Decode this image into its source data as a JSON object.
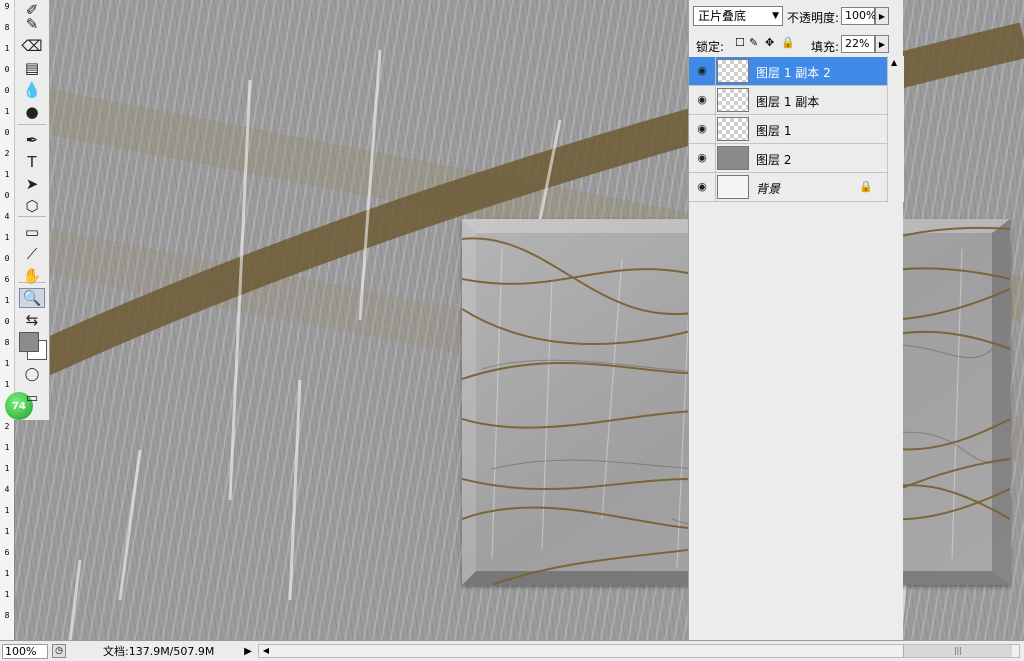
{
  "rulers": {
    "left_ticks": [
      "9",
      "8",
      "1",
      "0",
      "0",
      "1",
      "0",
      "2",
      "1",
      "0",
      "4",
      "1",
      "0",
      "6",
      "1",
      "0",
      "8",
      "1",
      "1",
      "1",
      "2",
      "1",
      "1",
      "4",
      "1",
      "1",
      "6",
      "1",
      "1",
      "8"
    ]
  },
  "toolbox": {
    "tools": [
      {
        "name": "eraser-history-icon",
        "glyph": "✐"
      },
      {
        "name": "history-brush-icon",
        "glyph": "✎"
      },
      {
        "name": "eraser-icon",
        "glyph": "⌫"
      },
      {
        "name": "gradient-icon",
        "glyph": "▤"
      },
      {
        "name": "blur-drop-icon",
        "glyph": "💧"
      },
      {
        "name": "dodge-icon",
        "glyph": "●"
      },
      {
        "name": "pen-icon",
        "glyph": "✒"
      },
      {
        "name": "type-icon",
        "glyph": "T"
      },
      {
        "name": "path-select-icon",
        "glyph": "➤"
      },
      {
        "name": "shape-icon",
        "glyph": "⬡"
      },
      {
        "name": "notes-icon",
        "glyph": "▭"
      },
      {
        "name": "eyedropper-icon",
        "glyph": "⟋"
      },
      {
        "name": "hand-icon",
        "glyph": "✋"
      },
      {
        "name": "zoom-icon",
        "glyph": "🔍"
      },
      {
        "name": "swap-colors-icon",
        "glyph": "⇆"
      }
    ],
    "quickmask_glyph": "◯",
    "screenmode_glyph": "▭",
    "badge": "74"
  },
  "layers_panel": {
    "blend_mode": "正片叠底",
    "opacity_label": "不透明度:",
    "opacity_value": "100%",
    "lock_label": "锁定:",
    "fill_label": "填充:",
    "fill_value": "22%",
    "layers": [
      {
        "name": "图层 1 副本 2",
        "thumb": "checker",
        "active": true,
        "locked": false,
        "italic": false
      },
      {
        "name": "图层 1 副本",
        "thumb": "checker",
        "active": false,
        "locked": false,
        "italic": false
      },
      {
        "name": "图层 1",
        "thumb": "checker",
        "active": false,
        "locked": false,
        "italic": false
      },
      {
        "name": "图层 2",
        "thumb": "gray",
        "active": false,
        "locked": false,
        "italic": false
      },
      {
        "name": "背景",
        "thumb": "white",
        "active": false,
        "locked": true,
        "italic": true
      }
    ]
  },
  "statusbar": {
    "zoom": "100%",
    "doc_info": "文档:137.9M/507.9M"
  },
  "colors": {
    "accent": "#3f8ae6",
    "band": "#6d5a35",
    "wave_line": "#7a6233"
  }
}
